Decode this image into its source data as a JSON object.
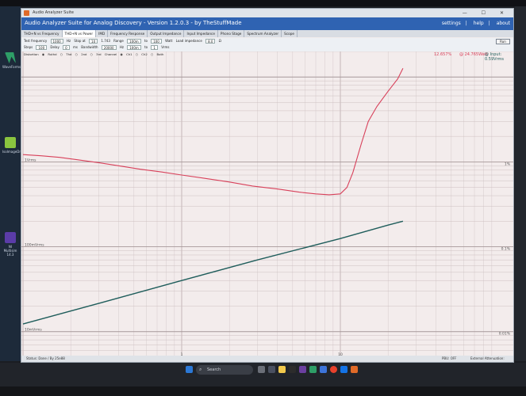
{
  "window": {
    "title_bar": "Audio Analyzer Suite",
    "app_title": "Audio Analyzer Suite for Analog Discovery - Version  1.2.0.3  - by TheStuffMade",
    "links": [
      "settings",
      "help",
      "about"
    ]
  },
  "desktop": {
    "icons": [
      {
        "label": "WaveForms"
      },
      {
        "label": "IsoImageDrive"
      },
      {
        "label": "NI Multisim 14.3"
      }
    ]
  },
  "tabs": [
    {
      "label": "THD+N vs Frequency",
      "active": false
    },
    {
      "label": "THD+N vs Power",
      "active": true
    },
    {
      "label": "IMD",
      "active": false
    },
    {
      "label": "Frequency Response",
      "active": false
    },
    {
      "label": "Output Impedance",
      "active": false
    },
    {
      "label": "Input Impedance",
      "active": false
    },
    {
      "label": "Phono Stage",
      "active": false
    },
    {
      "label": "Spectrum Analyzer",
      "active": false
    },
    {
      "label": "Scope",
      "active": false
    }
  ],
  "controls": {
    "test_frequency_label": "Test frequency",
    "test_frequency_value": "1000",
    "hz": "Hz",
    "stop_at_label": "Stop at",
    "stop_at_value": "10",
    "stop_at_value2": "1.743",
    "range_label": "Range",
    "range_value": "100m",
    "to_label": "to",
    "range_to_value": "100",
    "watt_label": "Watt",
    "load_impedance_label": "Load impedance",
    "load_impedance_value": "8.0",
    "ohm": "Ω",
    "steps_label": "Steps",
    "steps_value": "100",
    "delay_label": "Delay",
    "delay_value": "0",
    "ms": "ms",
    "bandwidth_label": "Bandwidth",
    "bandwidth_value": "20000",
    "vrms_range_from": "100m",
    "vrms_range_to": "1",
    "vrms_label": "Vrms",
    "run_label": "Run",
    "row3": {
      "distortion_label": "Distortion",
      "options": [
        "Ruthd",
        "Thd",
        "2nd",
        "3rd"
      ],
      "channel_label": "Channel",
      "channel_options": [
        "Ch1",
        "Ch2",
        "Both"
      ]
    }
  },
  "readouts": {
    "thd_percent": "12.657%",
    "power": "@ 24.765Watt",
    "input": "@ Input: 0.59Vrms"
  },
  "chart_data": {
    "type": "line",
    "xscale": "log",
    "yscale": "log",
    "x_tick_labels": [
      "1",
      "10"
    ],
    "y_left_labels": [
      "1Vrms",
      "100mVrms",
      "10mVrms"
    ],
    "y_right_labels": [
      "1%",
      "0.1%",
      "0.01%"
    ],
    "grid": true,
    "series": [
      {
        "color": "#d8405a",
        "points": [
          [
            0.1,
            1.22
          ],
          [
            0.13,
            1.18
          ],
          [
            0.17,
            1.13
          ],
          [
            0.22,
            1.06
          ],
          [
            0.3,
            0.98
          ],
          [
            0.4,
            0.9
          ],
          [
            0.55,
            0.82
          ],
          [
            0.75,
            0.76
          ],
          [
            1.0,
            0.7
          ],
          [
            1.4,
            0.64
          ],
          [
            2.0,
            0.58
          ],
          [
            2.8,
            0.52
          ],
          [
            4.0,
            0.48
          ],
          [
            5.5,
            0.44
          ],
          [
            7.0,
            0.42
          ],
          [
            8.5,
            0.41
          ],
          [
            10.0,
            0.42
          ],
          [
            11.0,
            0.5
          ],
          [
            12.0,
            0.75
          ],
          [
            13.5,
            1.6
          ],
          [
            15.0,
            3.0
          ],
          [
            17.0,
            4.5
          ],
          [
            20.0,
            6.8
          ],
          [
            23.0,
            9.5
          ],
          [
            24.8,
            12.657
          ]
        ]
      },
      {
        "color": "#1f5d5b",
        "points": [
          [
            0.1,
            0.0123
          ],
          [
            0.3,
            0.0215
          ],
          [
            1.0,
            0.04
          ],
          [
            3.0,
            0.07
          ],
          [
            10.0,
            0.125
          ],
          [
            20.0,
            0.18
          ],
          [
            24.8,
            0.2
          ]
        ]
      }
    ]
  },
  "status": {
    "left": "Status: Done / By 25e88",
    "middle": "PBU: OFF",
    "right": "External Attenuation: 1.000"
  },
  "taskbar": {
    "search_placeholder": "Search"
  }
}
